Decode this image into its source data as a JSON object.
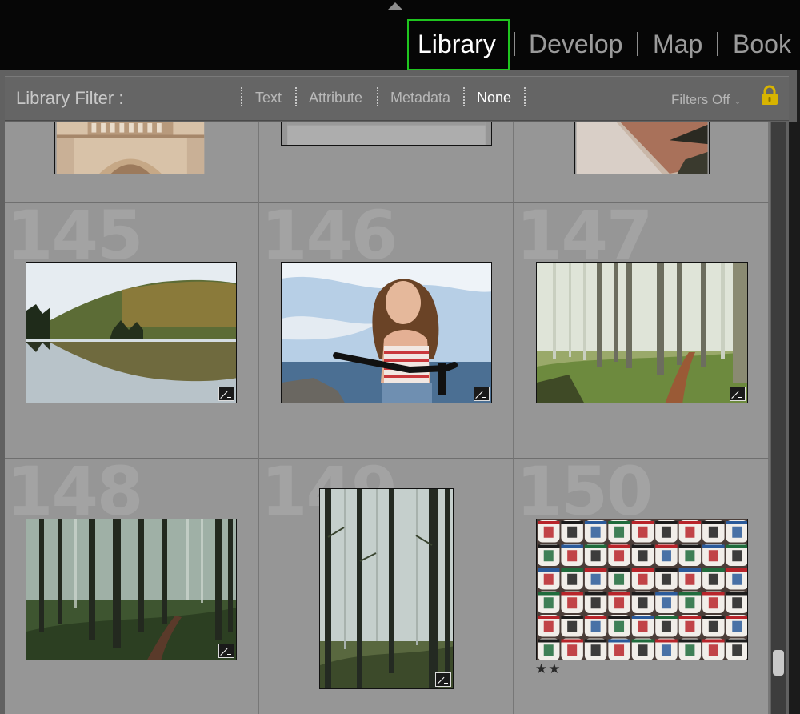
{
  "modules": {
    "library": "Library",
    "develop": "Develop",
    "map": "Map",
    "book": "Book"
  },
  "filter_bar": {
    "title": "Library Filter :",
    "tabs": [
      "Text",
      "Attribute",
      "Metadata",
      "None"
    ],
    "active_tab": "None",
    "filters_preset": "Filters Off",
    "lock_icon": "padlock-icon"
  },
  "grid": {
    "cells": [
      {
        "index": "145",
        "photo": "lake-forest-reflection"
      },
      {
        "index": "146",
        "photo": "woman-bicycle-beach"
      },
      {
        "index": "147",
        "photo": "misty-forest-trail"
      },
      {
        "index": "148",
        "photo": "dark-forest-trail"
      },
      {
        "index": "149",
        "photo": "foggy-tall-trees"
      },
      {
        "index": "150",
        "photo": "sake-barrels",
        "stars": "★★"
      }
    ],
    "badge_icon": "develop-adjusted-icon"
  },
  "colors": {
    "active_module_outline": "#1fc51f",
    "cell_background": "#969696",
    "lock": "#d8b400"
  }
}
